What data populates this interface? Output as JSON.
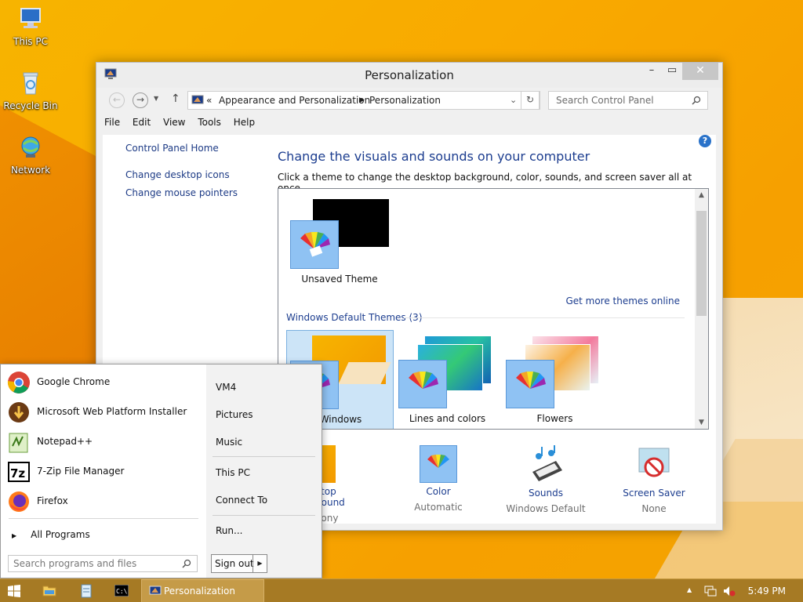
{
  "desktop": {
    "icons": [
      {
        "label": "This PC"
      },
      {
        "label": "Recycle Bin"
      },
      {
        "label": "Network"
      }
    ]
  },
  "window": {
    "title": "Personalization",
    "address": {
      "overflow": "«",
      "crumbs": [
        "Appearance and Personalization",
        "Personalization"
      ]
    },
    "search_placeholder": "Search Control Panel",
    "menu": [
      "File",
      "Edit",
      "View",
      "Tools",
      "Help"
    ],
    "left_links": [
      "Control Panel Home",
      "Change desktop icons",
      "Change mouse pointers"
    ],
    "heading": "Change the visuals and sounds on your computer",
    "subheading": "Click a theme to change the desktop background, color, sounds, and screen saver all at once.",
    "unsaved_theme": "Unsaved Theme",
    "get_more": "Get more themes online",
    "group_header": "Windows Default Themes (3)",
    "themes": [
      "Windows",
      "Lines and colors",
      "Flowers"
    ],
    "settings": [
      {
        "label": "Desktop Background",
        "value": "Harmony"
      },
      {
        "label": "Color",
        "value": "Automatic"
      },
      {
        "label": "Sounds",
        "value": "Windows Default"
      },
      {
        "label": "Screen Saver",
        "value": "None"
      }
    ]
  },
  "start_menu": {
    "programs": [
      "Google Chrome",
      "Microsoft Web Platform Installer",
      "Notepad++",
      "7-Zip File Manager",
      "Firefox"
    ],
    "all_programs": "All Programs",
    "search_placeholder": "Search programs and files",
    "right_items": [
      "VM4",
      "Pictures",
      "Music",
      "This PC",
      "Connect To",
      "Run..."
    ],
    "sign_out": "Sign out"
  },
  "taskbar": {
    "active_window": "Personalization",
    "clock": "5:49 PM"
  },
  "colors": {
    "accent_link": "#1c3d8f",
    "taskbar": "#a67a24",
    "wallpaper": "#f7b400"
  }
}
